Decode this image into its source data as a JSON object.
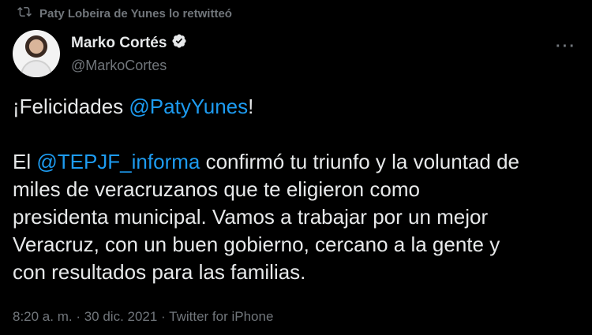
{
  "retweet": {
    "text": "Paty Lobeira de Yunes lo retwitteó"
  },
  "author": {
    "name": "Marko Cortés",
    "handle": "@MarkoCortes"
  },
  "more_label": "···",
  "tweet": {
    "greeting_prefix": "¡Felicidades ",
    "greeting_mention": "@PatyYunes",
    "greeting_suffix": "!",
    "body_prefix": "El ",
    "body_mention": "@TEPJF_informa",
    "body_rest_1": " confirmó tu triunfo y la voluntad de",
    "body_line_2": "miles de veracruzanos que te eligieron como",
    "body_line_3": "presidenta municipal. Vamos a trabajar por un mejor",
    "body_line_4": "Veracruz, con un buen gobierno,  cercano a la gente y",
    "body_line_5": "con resultados para las familias."
  },
  "meta": {
    "text": "8:20 a. m. · 30 dic. 2021 · Twitter for iPhone"
  },
  "colors": {
    "accent": "#1d9bf0",
    "muted": "#71767b",
    "text": "#e7e9ea",
    "background": "#000000"
  }
}
